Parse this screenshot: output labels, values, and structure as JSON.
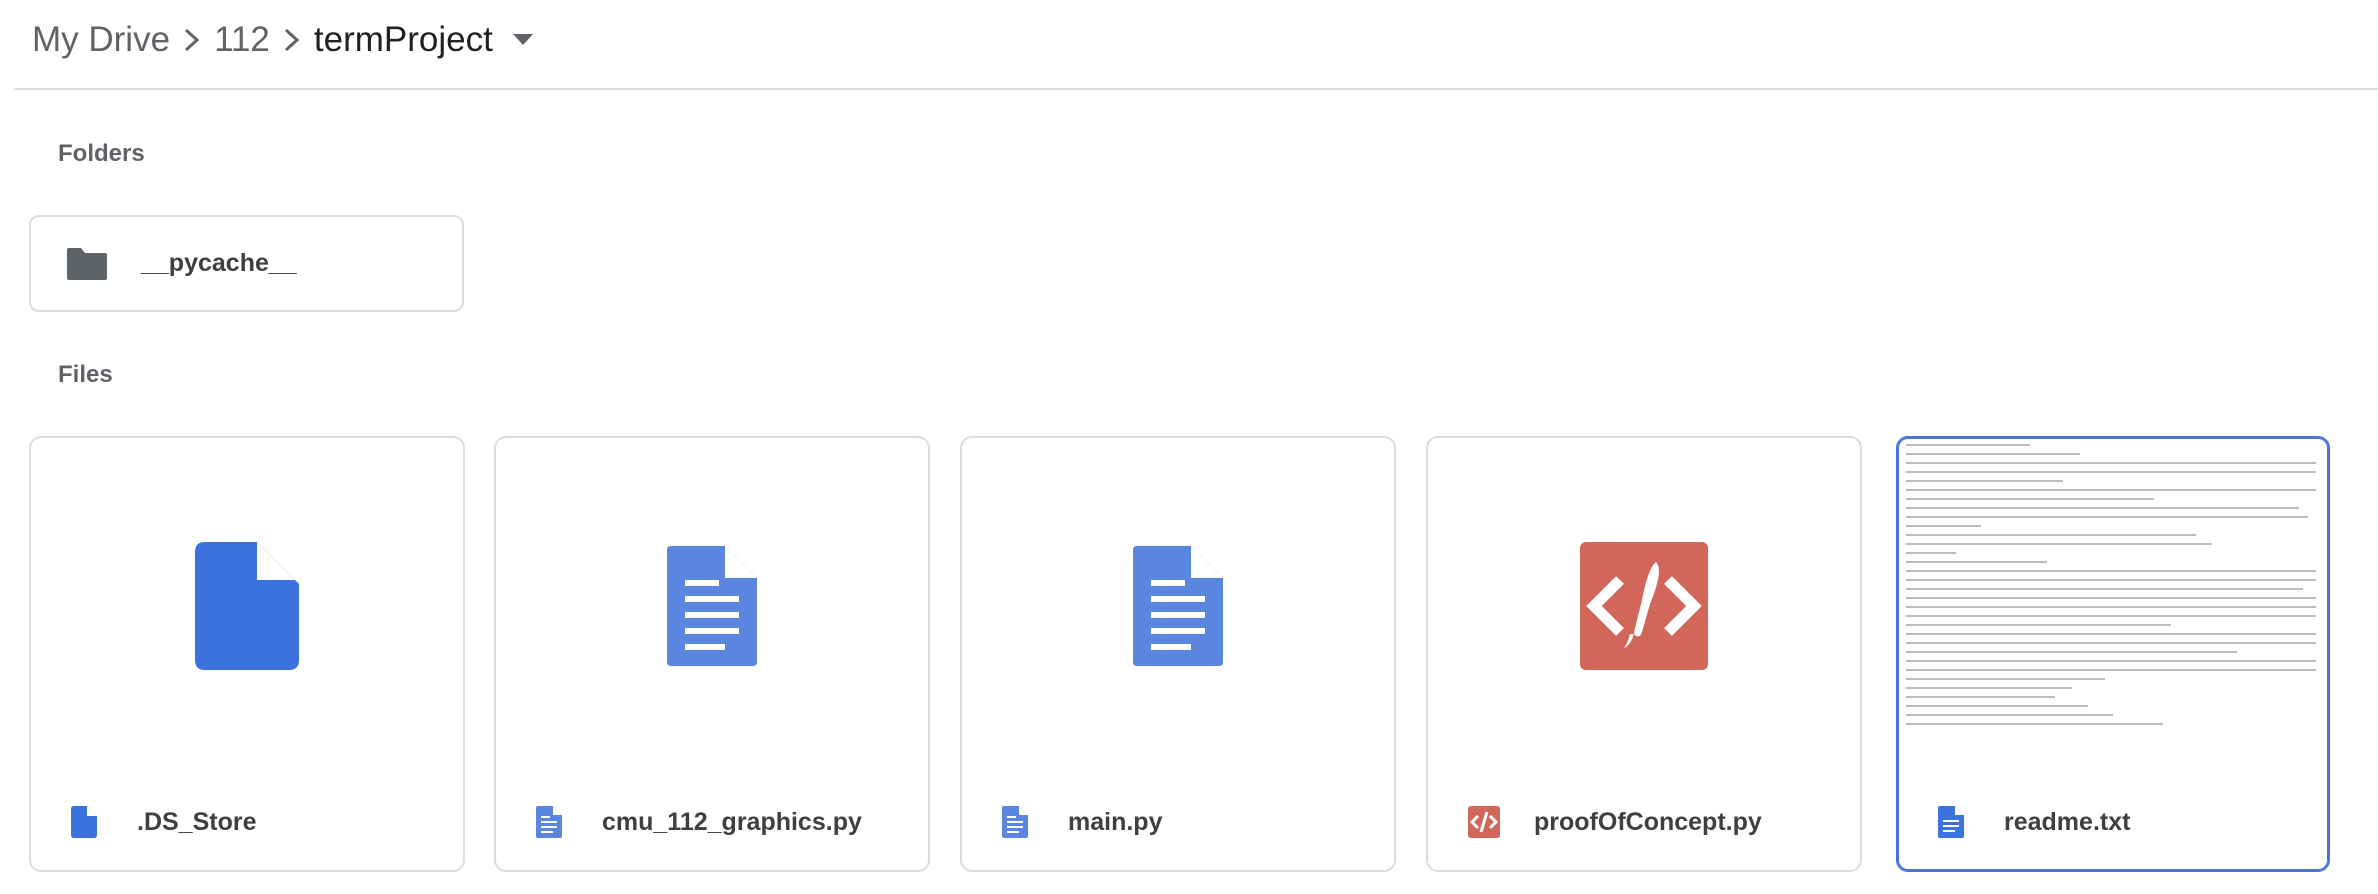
{
  "breadcrumb": {
    "items": [
      "My Drive",
      "112"
    ],
    "current": "termProject"
  },
  "folders": {
    "label": "Folders",
    "items": [
      {
        "name": "__pycache__",
        "icon": "folder-icon"
      }
    ]
  },
  "files": {
    "label": "Files",
    "items": [
      {
        "name": ".DS_Store",
        "type": "generic",
        "icon": "file-icon",
        "color": "#3b72e0"
      },
      {
        "name": "cmu_112_graphics.py",
        "type": "doc",
        "icon": "document-icon",
        "color": "#5b86e0"
      },
      {
        "name": "main.py",
        "type": "doc",
        "icon": "document-icon",
        "color": "#5b86e0"
      },
      {
        "name": "proofOfConcept.py",
        "type": "code",
        "icon": "code-icon",
        "color": "#d2665a"
      },
      {
        "name": "readme.txt",
        "type": "text",
        "icon": "document-icon",
        "color": "#3b72e0",
        "selected": true
      }
    ]
  },
  "colors": {
    "selection": "#4a73d9",
    "border": "#dadce0",
    "folder": "#5f6368"
  }
}
